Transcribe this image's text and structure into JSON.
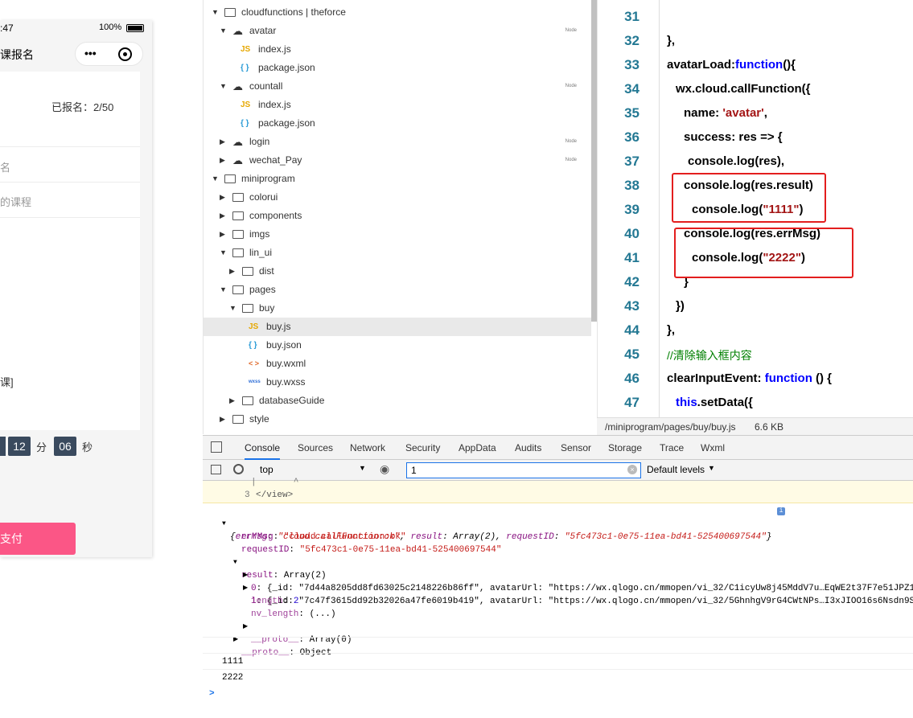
{
  "phone": {
    "time": ":47",
    "battery": "100%",
    "nav_title": "课报名",
    "menu_dots": "•••",
    "registered": "已报名：2/50",
    "row1": "名",
    "row2": "的课程",
    "row3": "课]",
    "countdown_min": "12",
    "countdown_min_unit": "分",
    "countdown_sec": "06",
    "countdown_sec_unit": "秒",
    "pay_label": "支付"
  },
  "tree": {
    "items": [
      {
        "label": "cloudfunctions | theforce"
      },
      {
        "label": "avatar",
        "badge": "Node"
      },
      {
        "label": "index.js",
        "icon": "JS"
      },
      {
        "label": "package.json",
        "icon": "{ }"
      },
      {
        "label": "countall",
        "badge": "Node"
      },
      {
        "label": "index.js",
        "icon": "JS"
      },
      {
        "label": "package.json",
        "icon": "{ }"
      },
      {
        "label": "login",
        "badge": "Node"
      },
      {
        "label": "wechat_Pay",
        "badge": "Node"
      },
      {
        "label": "miniprogram"
      },
      {
        "label": "colorui"
      },
      {
        "label": "components"
      },
      {
        "label": "imgs"
      },
      {
        "label": "lin_ui"
      },
      {
        "label": "dist"
      },
      {
        "label": "pages"
      },
      {
        "label": "buy"
      },
      {
        "label": "buy.js",
        "icon": "JS"
      },
      {
        "label": "buy.json",
        "icon": "{ }"
      },
      {
        "label": "buy.wxml",
        "icon": "< >"
      },
      {
        "label": "buy.wxss",
        "icon": "wxss"
      },
      {
        "label": "databaseGuide"
      },
      {
        "label": "style"
      }
    ]
  },
  "editor": {
    "lines": [
      {
        "n": "31"
      },
      {
        "n": "32"
      },
      {
        "n": "33"
      },
      {
        "n": "34"
      },
      {
        "n": "35"
      },
      {
        "n": "36"
      },
      {
        "n": "37"
      },
      {
        "n": "38"
      },
      {
        "n": "39"
      },
      {
        "n": "40"
      },
      {
        "n": "41"
      },
      {
        "n": "42"
      },
      {
        "n": "43"
      },
      {
        "n": "44"
      },
      {
        "n": "45"
      },
      {
        "n": "46"
      },
      {
        "n": "47"
      }
    ],
    "code": {
      "l32": "},",
      "l33a": "avatarLoad:",
      "l33b": "function",
      "l33c": "(){",
      "l34": "wx.cloud.callFunction({",
      "l35a": "name: ",
      "l35b": "'avatar'",
      "l35c": ",",
      "l36": "success: res => {",
      "l37": "console.log(res),",
      "l38": "console.log(res.result)",
      "l39a": "console.log(",
      "l39b": "\"1111\"",
      "l39c": ")",
      "l40": "console.log(res.errMsg)",
      "l41a": "console.log(",
      "l41b": "\"2222\"",
      "l41c": ")",
      "l42": "}",
      "l43": "})",
      "l44": "},",
      "l45": "//清除输入框内容",
      "l46a": "clearInputEvent: ",
      "l46b": "function",
      "l46c": " () {",
      "l47a": "this",
      "l47b": ".setData({"
    },
    "file_path": "/miniprogram/pages/buy/buy.js",
    "file_size": "6.6 KB"
  },
  "devtools": {
    "tabs": [
      "Console",
      "Sources",
      "Network",
      "Security",
      "AppData",
      "Audits",
      "Sensor",
      "Storage",
      "Trace",
      "Wxml"
    ],
    "context": "top",
    "filter_value": "1",
    "levels": "Default levels",
    "console": {
      "caret_line": "|       ^",
      "view_line_num": "3",
      "view_line": "</view>",
      "obj_head_a": "{",
      "obj_head_k1": "errMsg",
      "obj_head_v1": "\"cloud.callFunction:ok\"",
      "obj_head_k2": "result",
      "obj_head_v2": "Array(2)",
      "obj_head_k3": "requestID",
      "obj_head_v3": "\"5fc473c1-0e75-11ea-bd41-525400697544\"",
      "errmsg_k": "errMsg",
      "errmsg_v": "\"cloud.callFunction:ok\"",
      "reqid_k": "requestID",
      "reqid_v": "\"5fc473c1-0e75-11ea-bd41-525400697544\"",
      "result_k": "result",
      "result_v": "Array(2)",
      "item0_k": "0",
      "item0_v": "{_id: \"7d44a8205dd8fd63025c2148226b86ff\", avatarUrl: \"https://wx.qlogo.cn/mmopen/vi_32/C1icyUw8j45MddV7u…EqWE2t37F7e51JPZ1",
      "item1_k": "1",
      "item1_v": "{_id: \"7c47f3615dd92b32026a47fe6019b419\", avatarUrl: \"https://wx.qlogo.cn/mmopen/vi_32/5GhnhgV9rG4CWtNPs…I3xJIOO16s6Nsdn9S",
      "length_k": "length",
      "length_v": "2",
      "nvlen_k": "nv_length",
      "nvlen_v": "(...)",
      "proto1_k": "__proto__",
      "proto1_v": "Array(0)",
      "proto2_k": "__proto__",
      "proto2_v": "Object",
      "log1": "1111",
      "log2": "2222",
      "prompt": ">"
    }
  }
}
